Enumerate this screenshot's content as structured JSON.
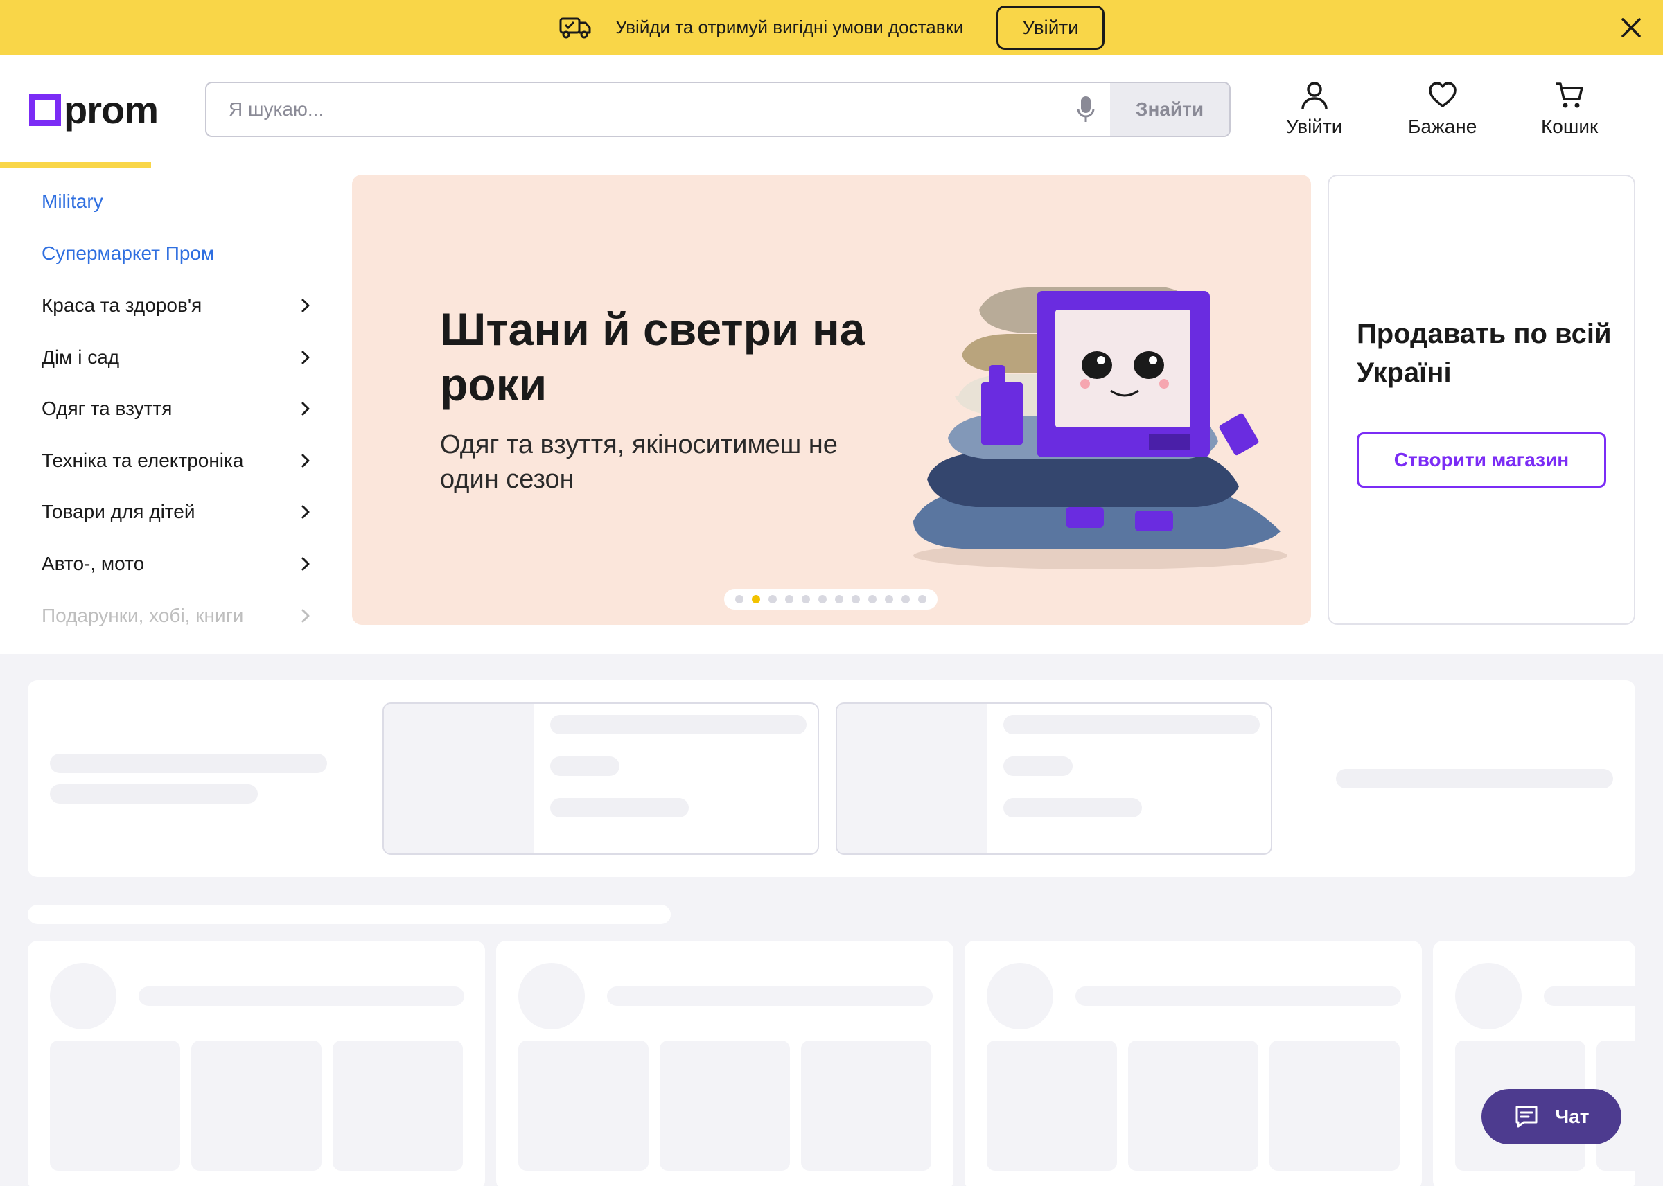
{
  "promo": {
    "text": "Увійди та отримуй вигідні умови доставки",
    "login_label": "Увійти",
    "truck_icon": "delivery-truck-icon",
    "close_icon": "close-icon"
  },
  "header": {
    "logo_text": "prom",
    "search_placeholder": "Я шукаю...",
    "search_button": "Знайти",
    "actions": {
      "login": "Увійти",
      "wishlist": "Бажане",
      "cart": "Кошик"
    }
  },
  "sidebar": {
    "items": [
      {
        "label": "Military",
        "type": "link"
      },
      {
        "label": "Супермаркет Пром",
        "type": "link"
      },
      {
        "label": "Краса та здоров'я",
        "type": "category"
      },
      {
        "label": "Дім і сад",
        "type": "category"
      },
      {
        "label": "Одяг та взуття",
        "type": "category"
      },
      {
        "label": "Техніка та електроніка",
        "type": "category"
      },
      {
        "label": "Товари для дітей",
        "type": "category"
      },
      {
        "label": "Авто-, мото",
        "type": "category"
      },
      {
        "label": "Подарунки, хобі, книги",
        "type": "category"
      }
    ]
  },
  "banner": {
    "title": "Штани й светри на роки",
    "subtitle": "Одяг та взуття, якіноситимеш не один сезон",
    "slide_count": 12,
    "active_slide": 2
  },
  "sell_card": {
    "title": "Продавать по всій Україні",
    "button": "Створити магазин"
  },
  "chat": {
    "label": "Чат"
  },
  "colors": {
    "promo_bg": "#f9d648",
    "brand_purple": "#7b2cf5",
    "link_blue": "#2f6fe0",
    "banner_bg": "#fbe6db",
    "chat_bg": "#4d3b8f"
  }
}
